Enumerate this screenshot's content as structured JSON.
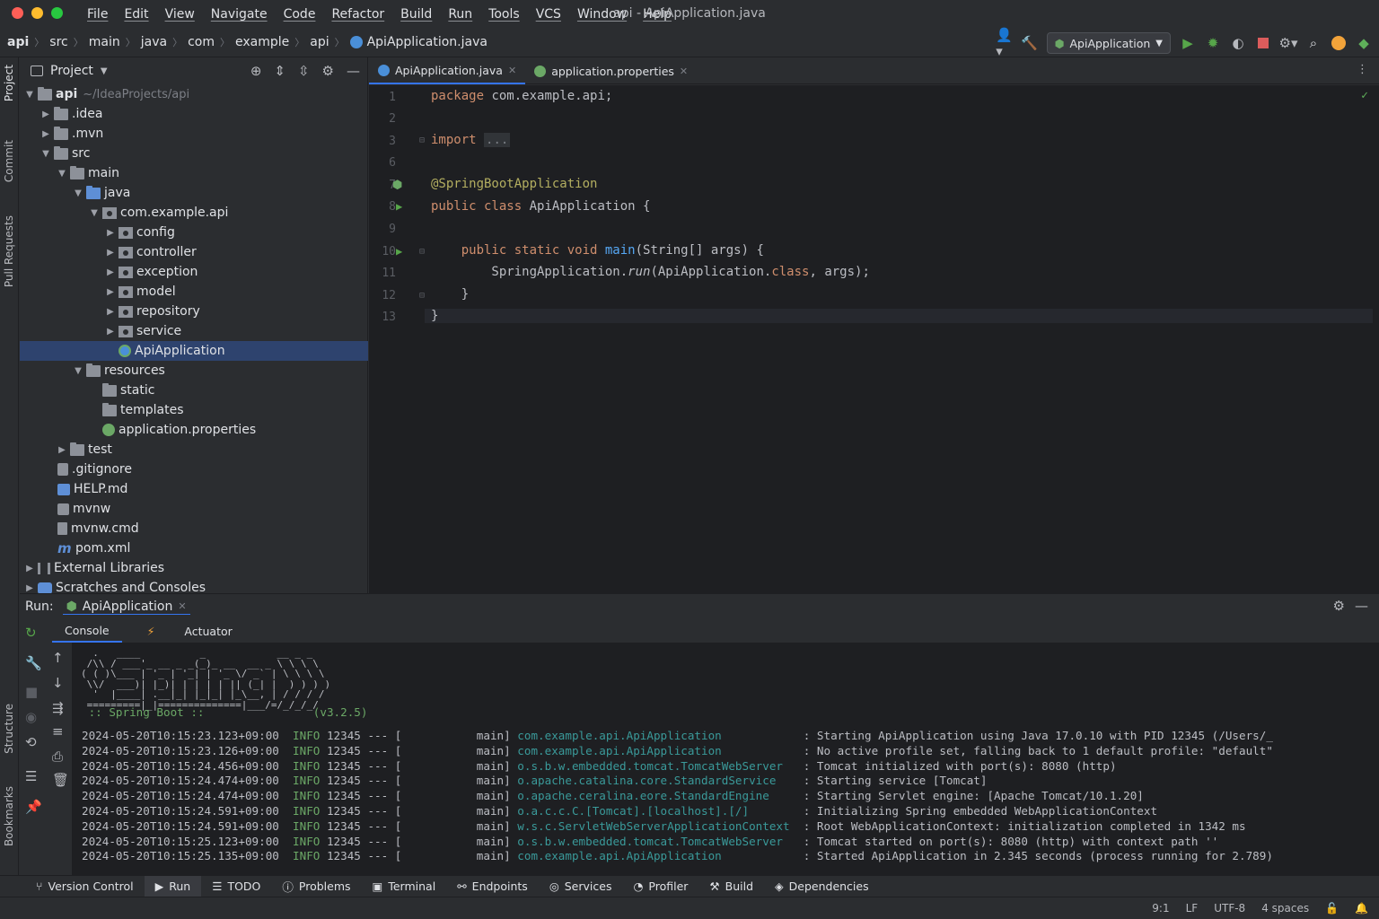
{
  "window": {
    "title": "api - ApiApplication.java"
  },
  "menu": [
    "File",
    "Edit",
    "View",
    "Navigate",
    "Code",
    "Refactor",
    "Build",
    "Run",
    "Tools",
    "VCS",
    "Window",
    "Help"
  ],
  "breadcrumb": [
    "api",
    "src",
    "main",
    "java",
    "com",
    "example",
    "api",
    "ApiApplication.java"
  ],
  "toolbar": {
    "run_config": "ApiApplication"
  },
  "left_strip": [
    "Project",
    "Commit",
    "Pull Requests",
    "Structure",
    "Bookmarks"
  ],
  "project": {
    "title": "Project",
    "root_label": "api",
    "root_path": "~/IdeaProjects/api",
    "items": [
      {
        "label": ".idea"
      },
      {
        "label": ".mvn"
      },
      {
        "label": "src"
      },
      {
        "label": "main"
      },
      {
        "label": "java"
      },
      {
        "label": "com.example.api"
      },
      {
        "label": "config"
      },
      {
        "label": "controller"
      },
      {
        "label": "exception"
      },
      {
        "label": "model"
      },
      {
        "label": "repository"
      },
      {
        "label": "service"
      },
      {
        "label": "ApiApplication"
      },
      {
        "label": "resources"
      },
      {
        "label": "static"
      },
      {
        "label": "templates"
      },
      {
        "label": "application.properties"
      },
      {
        "label": "test"
      },
      {
        "label": ".gitignore"
      },
      {
        "label": "HELP.md"
      },
      {
        "label": "mvnw"
      },
      {
        "label": "mvnw.cmd"
      },
      {
        "label": "pom.xml"
      },
      {
        "label": "External Libraries"
      },
      {
        "label": "Scratches and Consoles"
      }
    ]
  },
  "editor": {
    "tabs": [
      {
        "label": "ApiApplication.java"
      },
      {
        "label": "application.properties"
      }
    ],
    "line_numbers": [
      "1",
      "2",
      "3",
      "6",
      "7",
      "8",
      "9",
      "10",
      "11",
      "12",
      "13"
    ],
    "code": {
      "l1a": "package",
      "l1b": " com.example.api;",
      "l3a": "import",
      "l3b": "...",
      "l6": "@SpringBootApplication",
      "l7a": "public class",
      "l7b": " ApiApplication {",
      "l9a": "    public static void ",
      "l9b": "main",
      "l9c": "(String[] args) {",
      "l10a": "        SpringApplication.",
      "l10b": "run",
      "l10c": "(ApiApplication.",
      "l10d": "class",
      "l10e": ", args);",
      "l11": "    }",
      "l12": "}"
    }
  },
  "run_panel": {
    "label": "Run:",
    "config": "ApiApplication",
    "subtabs": [
      "Console",
      "Actuator"
    ],
    "banner_version": " :: Spring Boot ::                (v3.2.5)",
    "logs": [
      {
        "ts": "2024-05-20T10:15:23.123+09:00",
        "lvl": "INFO",
        "pid": "12345 --- [",
        "thr": "           main]",
        "cls": "com.example.api.ApiApplication",
        "msg": ": Starting ApiApplication using Java 17.0.10 with PID 12345 (/Users/_"
      },
      {
        "ts": "2024-05-20T10:15:23.126+09:00",
        "lvl": "INFO",
        "pid": "12345 --- [",
        "thr": "           main]",
        "cls": "com.example.api.ApiApplication",
        "msg": ": No active profile set, falling back to 1 default profile: \"default\""
      },
      {
        "ts": "2024-05-20T10:15:24.456+09:00",
        "lvl": "INFO",
        "pid": "12345 --- [",
        "thr": "           main]",
        "cls": "o.s.b.w.embedded.tomcat.TomcatWebServer",
        "msg": ": Tomcat initialized with port(s): 8080 (http)"
      },
      {
        "ts": "2024-05-20T10:15:24.474+09:00",
        "lvl": "INFO",
        "pid": "12345 --- [",
        "thr": "           main]",
        "cls": "o.apache.catalina.core.StandardService",
        "msg": ": Starting service [Tomcat]"
      },
      {
        "ts": "2024-05-20T10:15:24.474+09:00",
        "lvl": "INFO",
        "pid": "12345 --- [",
        "thr": "           main]",
        "cls": "o.apache.ceralina.eore.StandardEngine",
        "msg": ": Starting Servlet engine: [Apache Tomcat/10.1.20]"
      },
      {
        "ts": "2024-05-20T10:15:24.591+09:00",
        "lvl": "INFO",
        "pid": "12345 --- [",
        "thr": "           main]",
        "cls": "o.a.c.c.C.[Tomcat].[localhost].[/]",
        "msg": ": Initializing Spring embedded WebApplicationContext"
      },
      {
        "ts": "2024-05-20T10:15:24.591+09:00",
        "lvl": "INFO",
        "pid": "12345 --- [",
        "thr": "           main]",
        "cls": "w.s.c.ServletWebServerApplicationContext",
        "msg": ": Root WebApplicationContext: initialization completed in 1342 ms"
      },
      {
        "ts": "2024-05-20T10:15:25.123+09:00",
        "lvl": "INFO",
        "pid": "12345 --- [",
        "thr": "           main]",
        "cls": "o.s.b.w.embedded.tomcat.TomcatWebServer",
        "msg": ": Tomcat started on port(s): 8080 (http) with context path ''"
      },
      {
        "ts": "2024-05-20T10:15:25.135+09:00",
        "lvl": "INFO",
        "pid": "12345 --- [",
        "thr": "           main]",
        "cls": "com.example.api.ApiApplication",
        "msg": ": Started ApiApplication in 2.345 seconds (process running for 2.789)"
      }
    ]
  },
  "tool_windows": [
    "Version Control",
    "Run",
    "TODO",
    "Problems",
    "Terminal",
    "Endpoints",
    "Services",
    "Profiler",
    "Build",
    "Dependencies"
  ],
  "status": {
    "position": "9:1",
    "line_sep": "LF",
    "encoding": "UTF-8",
    "indent": "4 spaces"
  }
}
